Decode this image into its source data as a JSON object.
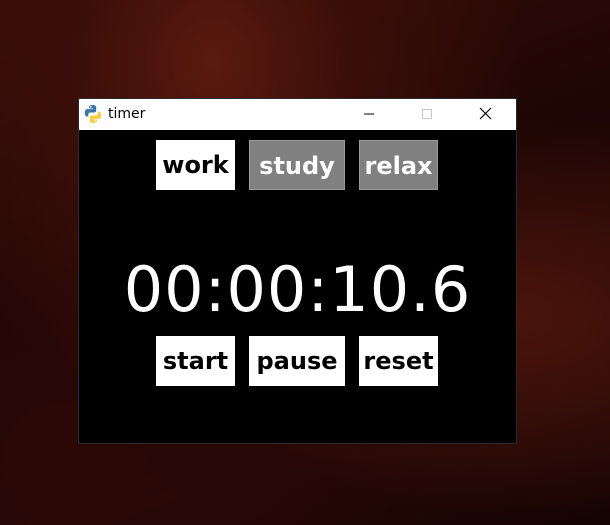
{
  "window": {
    "title": "timer",
    "app_icon": "python-icon",
    "controls": {
      "minimize_icon": "minimize-icon",
      "maximize_icon": "maximize-icon",
      "close_icon": "close-icon"
    }
  },
  "modes": {
    "work": "work",
    "study": "study",
    "relax": "relax",
    "active": "work"
  },
  "timer": {
    "display": "00:00:10.6"
  },
  "controls": {
    "start": "start",
    "pause": "pause",
    "reset": "reset"
  },
  "colors": {
    "window_background": "#000000",
    "active_button": "#ffffff",
    "inactive_button": "#808080",
    "timer_text": "#ffffff"
  }
}
